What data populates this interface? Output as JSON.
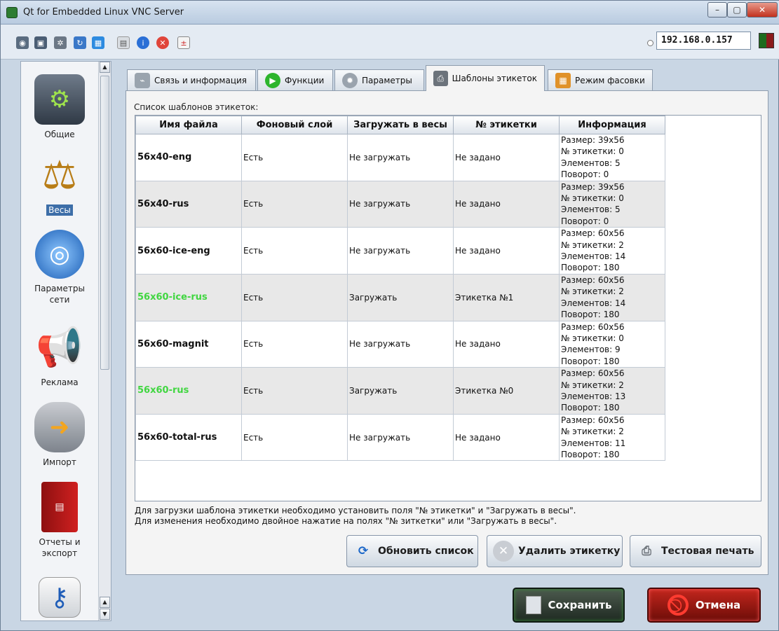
{
  "window": {
    "title": "Qt for Embedded Linux VNC Server",
    "minimize": "–",
    "maximize": "▢",
    "close": "✕"
  },
  "toolbar": {
    "icons": [
      "view-icon",
      "fullscreen-icon",
      "settings-icon",
      "refresh-icon",
      "windows-icon",
      "screenshot-icon",
      "info-icon",
      "close-icon",
      "document-icon"
    ],
    "ip_address": "192.168.0.157"
  },
  "sidebar": {
    "items": [
      {
        "label": "Общие",
        "icon": "mixer-icon"
      },
      {
        "label": "Весы",
        "icon": "scales-icon",
        "selected": true
      },
      {
        "label": "Параметры\nсети",
        "icon": "network-icon"
      },
      {
        "label": "Реклама",
        "icon": "megaphone-icon"
      },
      {
        "label": "Импорт",
        "icon": "database-icon"
      },
      {
        "label": "Отчеты и\nэкспорт",
        "icon": "report-book-icon"
      },
      {
        "label": "",
        "icon": "key-icon"
      }
    ]
  },
  "tabs": [
    {
      "label": "Связь и информация",
      "icon": "cable-icon"
    },
    {
      "label": "Функции",
      "icon": "play-icon"
    },
    {
      "label": "Параметры",
      "icon": "gear-icon"
    },
    {
      "label": "Шаблоны этикеток",
      "icon": "printer-icon",
      "active": true
    },
    {
      "label": "Режим фасовки",
      "icon": "package-icon"
    }
  ],
  "main": {
    "list_title": "Список шаблонов этикеток:",
    "columns": [
      "Имя файла",
      "Фоновый слой",
      "Загружать в весы",
      "№ этикетки",
      "Информация"
    ],
    "rows": [
      {
        "file": "56x40-eng",
        "bg": "Есть",
        "load": "Не загружать",
        "label_no": "Не задано",
        "info": [
          "Размер: 39x56",
          "№ этикетки: 0",
          "Элементов: 5",
          "Поворот: 0"
        ],
        "loaded": false
      },
      {
        "file": "56x40-rus",
        "bg": "Есть",
        "load": "Не загружать",
        "label_no": "Не задано",
        "info": [
          "Размер: 39x56",
          "№ этикетки: 0",
          "Элементов: 5",
          "Поворот: 0"
        ],
        "loaded": false
      },
      {
        "file": "56x60-ice-eng",
        "bg": "Есть",
        "load": "Не загружать",
        "label_no": "Не задано",
        "info": [
          "Размер: 60x56",
          "№ этикетки: 2",
          "Элементов: 14",
          "Поворот: 180"
        ],
        "loaded": false
      },
      {
        "file": "56x60-ice-rus",
        "bg": "Есть",
        "load": "Загружать",
        "label_no": "Этикетка №1",
        "info": [
          "Размер: 60x56",
          "№ этикетки: 2",
          "Элементов: 14",
          "Поворот: 180"
        ],
        "loaded": true
      },
      {
        "file": "56x60-magnit",
        "bg": "Есть",
        "load": "Не загружать",
        "label_no": "Не задано",
        "info": [
          "Размер: 60x56",
          "№ этикетки: 0",
          "Элементов: 9",
          "Поворот: 180"
        ],
        "loaded": false
      },
      {
        "file": "56x60-rus",
        "bg": "Есть",
        "load": "Загружать",
        "label_no": "Этикетка №0",
        "info": [
          "Размер: 60x56",
          "№ этикетки: 2",
          "Элементов: 13",
          "Поворот: 180"
        ],
        "loaded": true
      },
      {
        "file": "56x60-total-rus",
        "bg": "Есть",
        "load": "Не загружать",
        "label_no": "Не задано",
        "info": [
          "Размер: 60x56",
          "№ этикетки: 2",
          "Элементов: 11",
          "Поворот: 180"
        ],
        "loaded": false
      }
    ],
    "note_line1": "Для загрузки шаблона этикетки необходимо установить поля \"№ этикетки\" и \"Загружать в весы\".",
    "note_line2": "Для изменения необходимо двойное нажатие на полях \"№ зиткетки\" или \"Загружать в весы\".",
    "buttons": {
      "refresh": "Обновить список",
      "delete": "Удалить этикетку",
      "test_print": "Тестовая печать"
    }
  },
  "footer": {
    "save": "Сохранить",
    "cancel": "Отмена"
  },
  "colors": {
    "loaded_file": "#41d641",
    "selected_sidebar": "#3d6ea8"
  }
}
